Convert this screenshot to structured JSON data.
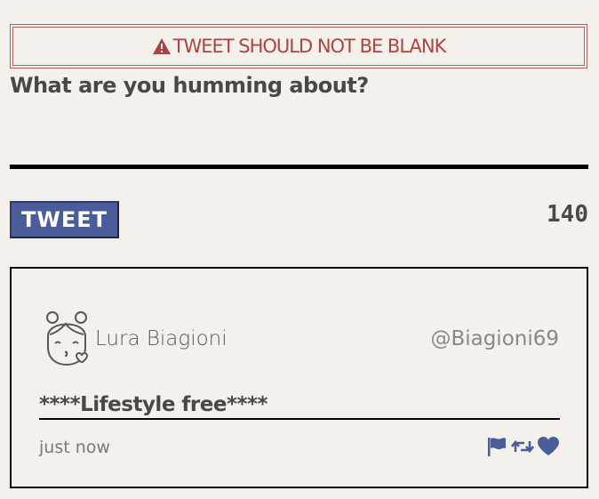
{
  "error": {
    "icon": "warning-triangle-icon",
    "message": "TWEET SHOULD NOT BE BLANK",
    "color": "#a94442"
  },
  "composer": {
    "prompt": "What are you humming about?",
    "value": "",
    "button_label": "TWEET",
    "char_count": "140",
    "button_color": "#4a5c9a"
  },
  "tweet": {
    "avatar_icon": "girl-avatar-icon",
    "name": "Lura Biagioni",
    "handle": "@Biagioni69",
    "text": "****Lifestyle free****",
    "timestamp": "just now",
    "actions": {
      "flag_icon": "flag-icon",
      "retweet_icon": "retweet-icon",
      "like_icon": "heart-icon",
      "color": "#4a5c9a"
    }
  }
}
